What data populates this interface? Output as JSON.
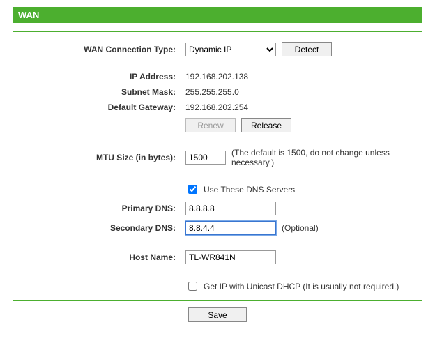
{
  "header": {
    "title": "WAN"
  },
  "labels": {
    "connection_type": "WAN Connection Type:",
    "ip_address": "IP Address:",
    "subnet_mask": "Subnet Mask:",
    "default_gateway": "Default Gateway:",
    "mtu_size": "MTU Size (in bytes):",
    "primary_dns": "Primary DNS:",
    "secondary_dns": "Secondary DNS:",
    "host_name": "Host Name:"
  },
  "values": {
    "connection_type": "Dynamic IP",
    "ip_address": "192.168.202.138",
    "subnet_mask": "255.255.255.0",
    "default_gateway": "192.168.202.254",
    "mtu_size": "1500",
    "primary_dns": "8.8.8.8",
    "secondary_dns": "8.8.4.4",
    "host_name": "TL-WR841N",
    "use_dns_checked": true,
    "unicast_dhcp_checked": false
  },
  "buttons": {
    "detect": "Detect",
    "renew": "Renew",
    "release": "Release",
    "save": "Save"
  },
  "hints": {
    "mtu": "(The default is 1500, do not change unless necessary.)",
    "use_dns": "Use These DNS Servers",
    "secondary_dns_optional": "(Optional)",
    "unicast_dhcp": "Get IP with Unicast DHCP (It is usually not required.)"
  }
}
